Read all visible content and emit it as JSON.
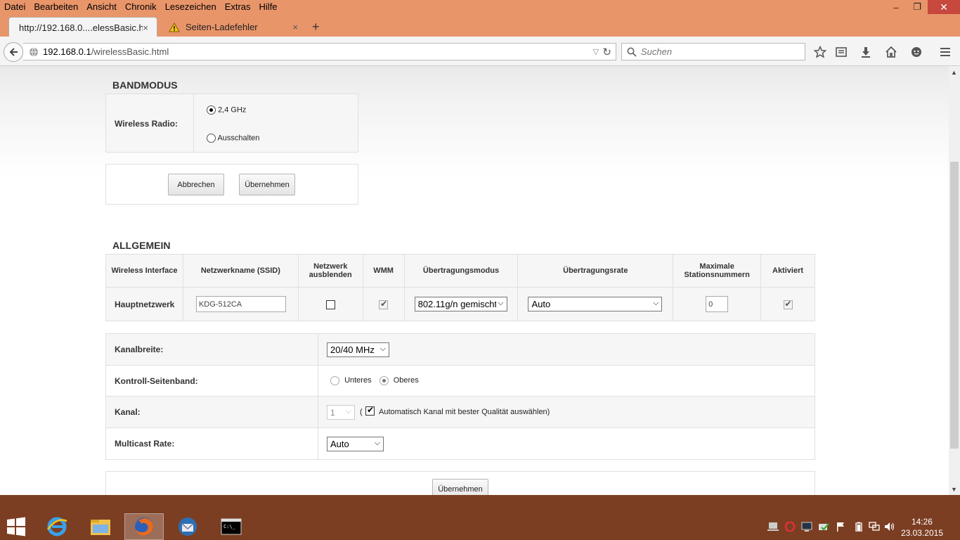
{
  "browser": {
    "menu": [
      "Datei",
      "Bearbeiten",
      "Ansicht",
      "Chronik",
      "Lesezeichen",
      "Extras",
      "Hilfe"
    ],
    "tabs": [
      {
        "label": "http://192.168.0....elessBasic.html",
        "close": "×"
      },
      {
        "label": "Seiten-Ladefehler",
        "close": "×"
      }
    ],
    "new_tab": "+",
    "url_host": "192.168.0.1",
    "url_path": "/wirelessBasic.html",
    "search_placeholder": "Suchen",
    "window_controls": [
      "–",
      "❐",
      "✕"
    ]
  },
  "bandmodus": {
    "title": "BANDMODUS",
    "label": "Wireless Radio:",
    "options": [
      {
        "label": "2,4 GHz",
        "checked": true
      },
      {
        "label": "Ausschalten",
        "checked": false
      }
    ],
    "cancel_label": "Abbrechen",
    "apply_label": "Übernehmen"
  },
  "allgemein": {
    "title": "ALLGEMEIN",
    "headers": [
      "Wireless Interface",
      "Netzwerkname (SSID)",
      "Netzwerk ausblenden",
      "WMM",
      "Übertragungsmodus",
      "Übertragungsrate",
      "Maximale Stationsnummern",
      "Aktiviert"
    ],
    "row": {
      "interface": "Hauptnetzwerk",
      "ssid": "KDG-512CA",
      "hide_network": false,
      "wmm": true,
      "mode": "802.11g/n gemischt",
      "rate": "Auto",
      "max_stations": "0",
      "enabled": true
    }
  },
  "settings": {
    "kanalbreite_label": "Kanalbreite:",
    "kanalbreite_value": "20/40 MHz",
    "seitenband_label": "Kontroll-Seitenband:",
    "seitenband_options": [
      {
        "label": "Unteres",
        "checked": false
      },
      {
        "label": "Oberes",
        "checked": true
      }
    ],
    "kanal_label": "Kanal:",
    "kanal_value": "1",
    "kanal_open_paren": "(",
    "auto_channel_checked": true,
    "auto_channel_label": "Automatisch Kanal mit bester Qualität auswählen)",
    "multicast_label": "Multicast Rate:",
    "multicast_value": "Auto",
    "apply_label": "Übernehmen"
  },
  "taskbar": {
    "time": "14:26",
    "date": "23.03.2015"
  },
  "colors": {
    "titlebar": "#e8956a",
    "taskbar": "#7b3e22",
    "close_button": "#c7483d"
  }
}
